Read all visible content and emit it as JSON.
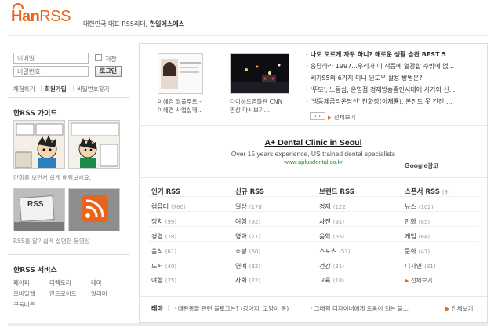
{
  "header": {
    "logo_han": "Han",
    "logo_rss": "RSS",
    "tagline_prefix": "대한민국 대표 RSS리더, ",
    "tagline_brand": "한일에스에스"
  },
  "login": {
    "id_placeholder": "이메일",
    "pw_placeholder": "비밀번호",
    "save_label": "저장",
    "login_button": "로그인",
    "links": [
      "체험하기",
      "회원가입",
      "비밀번호찾기"
    ]
  },
  "guide": {
    "title": "한RSS 가이드",
    "caption1": "만화를 보면서 쉽게 배워보세요.",
    "caption2": "RSS를 알기쉽게 설명한 동영상",
    "video_label": "RSS"
  },
  "services": {
    "title": "한RSS 서비스",
    "items": [
      "페이퍼",
      "디렉토리",
      "테마",
      "모바일웹",
      "안드로이드",
      "알리미",
      "구독버튼"
    ]
  },
  "featured": {
    "thumb1_caption": [
      "이혜경 월풀주트 -",
      "이혜경 사업실패..."
    ],
    "thumb2_caption": [
      "다이하드영화관 CNN",
      "영상 다시보기..."
    ],
    "news": [
      "나도 모르게 자꾸 하니? 해로운 생활 습관 BEST 5",
      "응답하라 1997...우리가 이 작품에 열광할 수밖에 없...",
      "베가S5의 6가지 미니 윈도우 활용 방법은?",
      "'뚜또', 노동쉼, 운영점 경제방송중인시대에 사기의 신...",
      "'냉동체곰리온당신' 천화장(이재룡), 본전도 못 건진 ..."
    ],
    "more": "전체보기"
  },
  "ad": {
    "title": "A+ Dental Clinic in Seoul",
    "desc": "Over 15 years experience, US trained dental specialists",
    "url": "www.aplusdental.co.kr",
    "google": "Google",
    "ad_label": "광고"
  },
  "categories": {
    "columns": [
      {
        "title": "인기 RSS",
        "count": "",
        "items": [
          [
            "컴퓨터",
            "(760)"
          ],
          [
            "정치",
            "(99)"
          ],
          [
            "경영",
            "(78)"
          ],
          [
            "음식",
            "(61)"
          ],
          [
            "도서",
            "(40)"
          ],
          [
            "여행",
            "(25)"
          ]
        ]
      },
      {
        "title": "신규 RSS",
        "count": "",
        "items": [
          [
            "일상",
            "(178)"
          ],
          [
            "여행",
            "(92)"
          ],
          [
            "영화",
            "(77)"
          ],
          [
            "쇼핑",
            "(60)"
          ],
          [
            "연예",
            "(32)"
          ],
          [
            "사회",
            "(22)"
          ]
        ]
      },
      {
        "title": "브랜드 RSS",
        "count": "",
        "items": [
          [
            "경제",
            "(122)"
          ],
          [
            "사진",
            "(91)"
          ],
          [
            "음악",
            "(65)"
          ],
          [
            "스포츠",
            "(53)"
          ],
          [
            "건강",
            "(31)"
          ],
          [
            "교육",
            "(18)"
          ]
        ]
      },
      {
        "title": "스폰서 RSS",
        "count": "(9)",
        "items": [
          [
            "뉴스",
            "(102)"
          ],
          [
            "만화",
            "(85)"
          ],
          [
            "게임",
            "(64)"
          ],
          [
            "문화",
            "(41)"
          ],
          [
            "디자인",
            "(31)"
          ]
        ]
      }
    ],
    "more": "전체보기"
  },
  "theme": {
    "label": "테마",
    "item1": "애완동물 관련 블로그는? (강아지, 고양이 등)",
    "item2": "그래픽 디자이너에게 도움이 되는 블...",
    "more": "전체보기"
  },
  "colors": {
    "accent": "#e8641b",
    "link": "#1a4fa0",
    "ad_url": "#2a8a2a"
  }
}
